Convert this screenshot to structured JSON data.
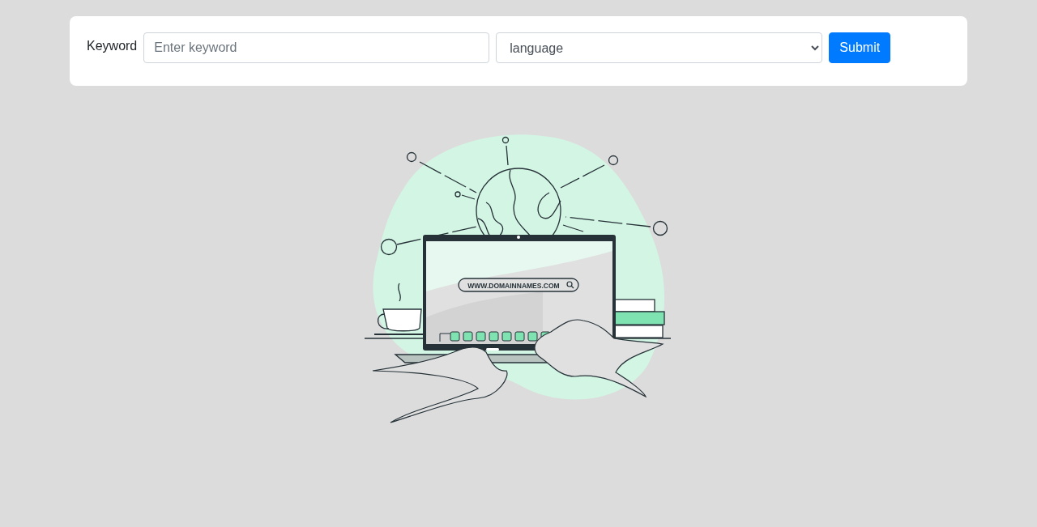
{
  "search_form": {
    "keyword_label": "Keyword",
    "keyword_placeholder": "Enter keyword",
    "language_select": "language",
    "submit_button": "Submit"
  },
  "illustration": {
    "address_bar_text": "WWW.DOMAINNAMES.COM"
  }
}
